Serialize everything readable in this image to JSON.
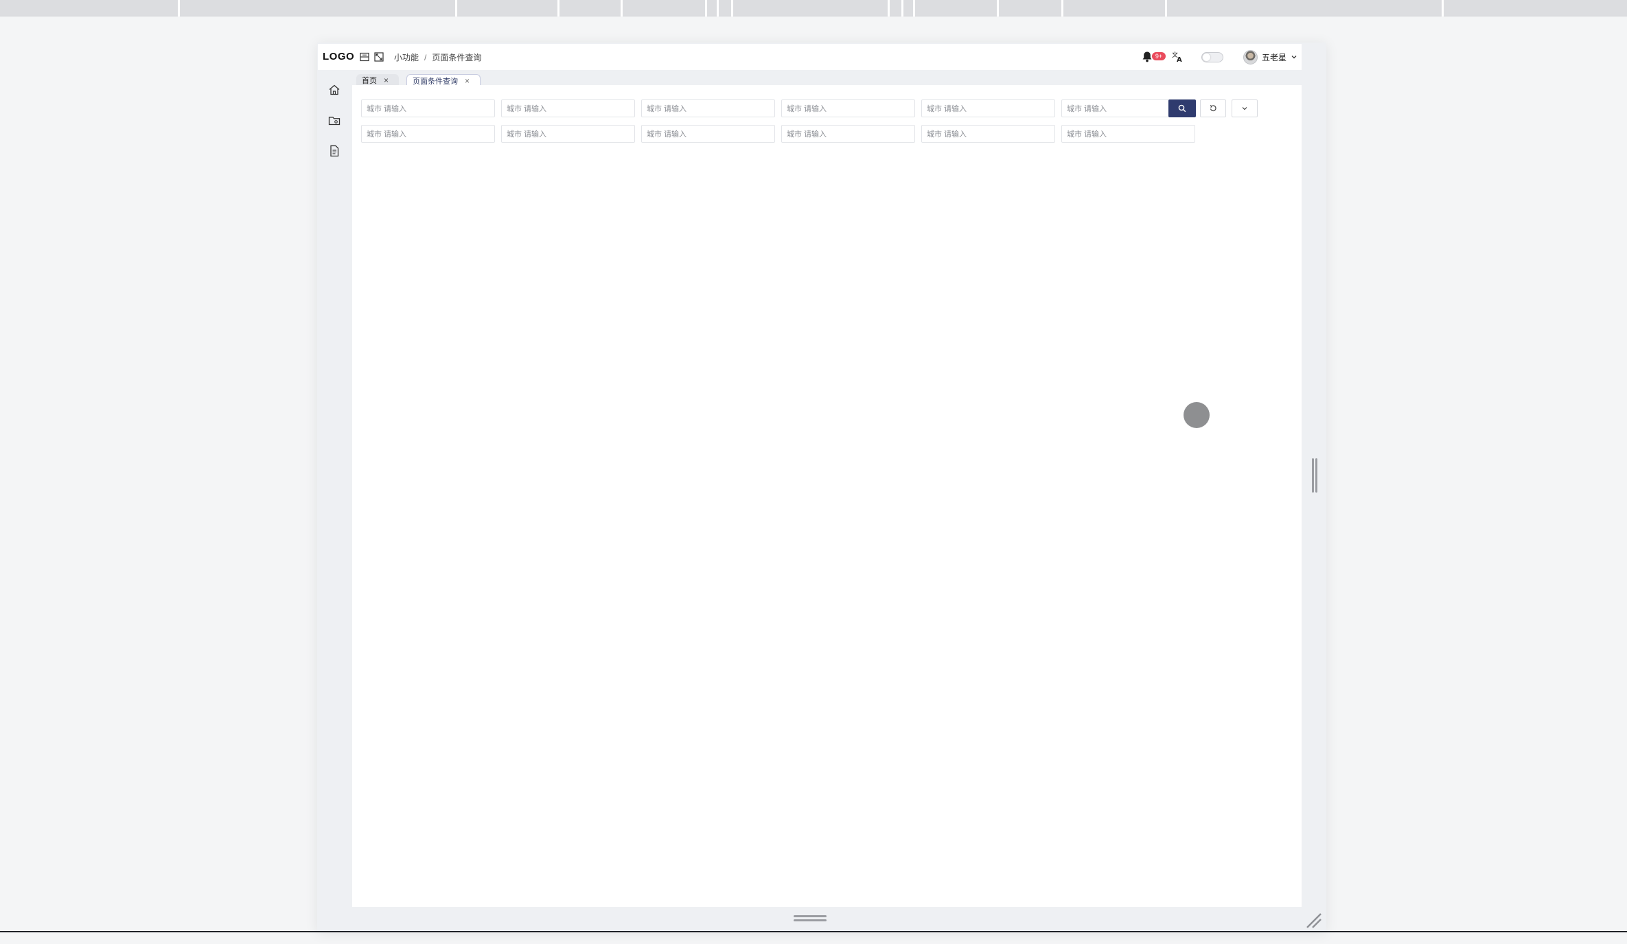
{
  "header": {
    "logo": "LOGO",
    "breadcrumb": [
      "小功能",
      "页面条件查询"
    ],
    "breadcrumb_separator": "/",
    "notification_badge": "9+",
    "user_name": "五老星"
  },
  "tabs": [
    {
      "label": "首页",
      "close": "×",
      "active": false
    },
    {
      "label": "页面条件查询",
      "close": "×",
      "active": true
    }
  ],
  "sidebar": {
    "icons": [
      "home-icon",
      "folder-icon",
      "document-icon"
    ]
  },
  "filters": {
    "label": "城市",
    "placeholder": "请输入",
    "rows": 2,
    "row1_count": 6,
    "row2_count": 6
  },
  "toolbar": {
    "search_icon": "search-icon",
    "reset_icon": "reset-icon",
    "expand_icon": "chevron-down-icon"
  },
  "colors": {
    "primary": "#2f3b6e",
    "badge": "#ea4b5c",
    "sidebar_bg": "#eef0f3",
    "page_bg": "#f4f5f6"
  }
}
